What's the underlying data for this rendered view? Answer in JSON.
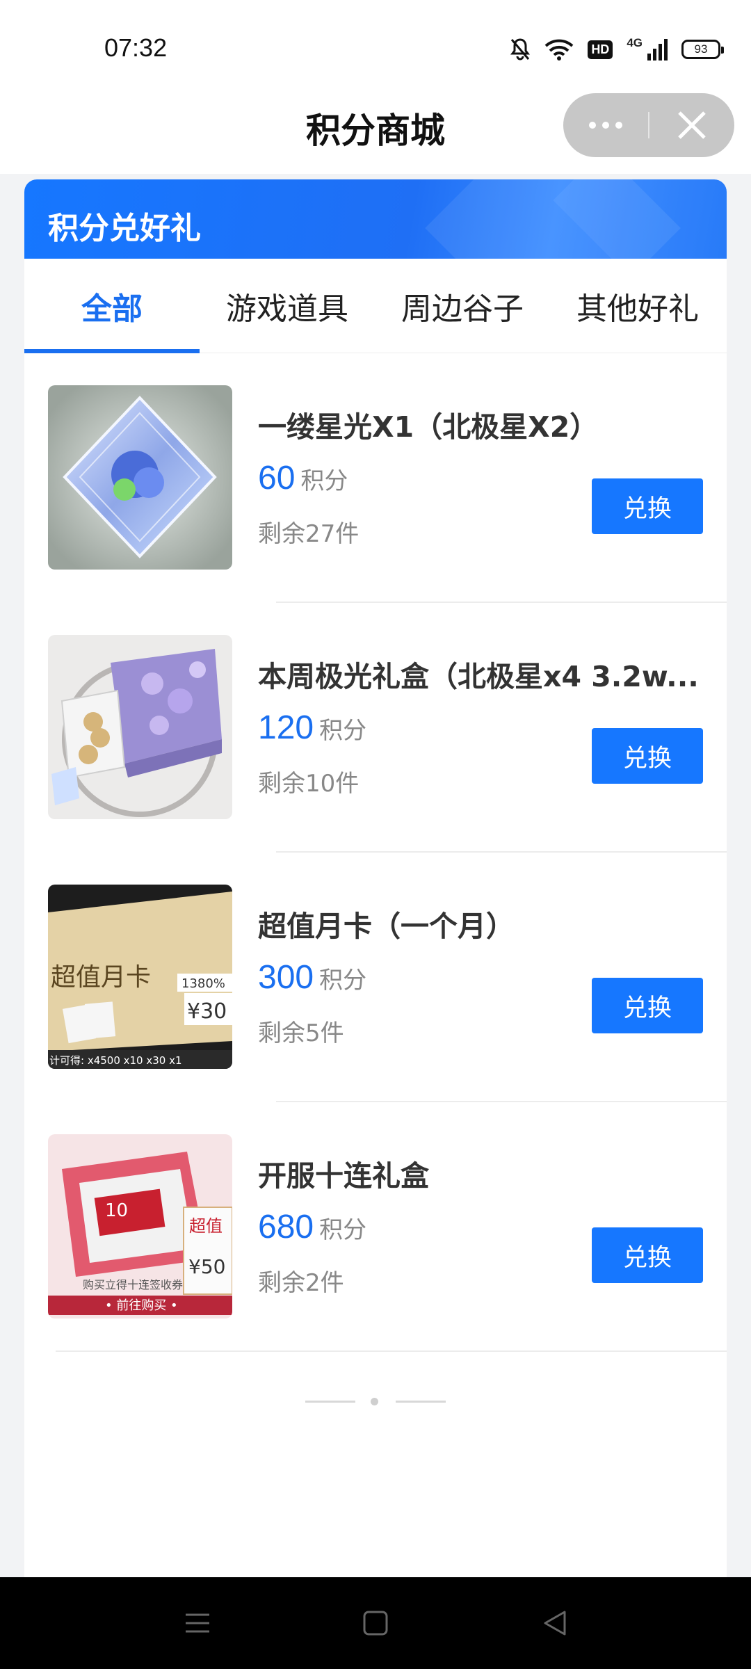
{
  "status_bar": {
    "time": "07:32",
    "network": "4G",
    "hd_badge": "HD",
    "battery_level": "93",
    "icons": [
      "mute-bell-icon",
      "wifi-icon",
      "hd-icon",
      "signal-icon",
      "battery-icon"
    ]
  },
  "header": {
    "title": "积分商城",
    "menu_icon": "more-dots-icon",
    "close_icon": "close-icon"
  },
  "banner": {
    "title": "积分兑好礼"
  },
  "tabs": [
    {
      "label": "全部",
      "active": true
    },
    {
      "label": "游戏道具",
      "active": false
    },
    {
      "label": "周边谷子",
      "active": false
    },
    {
      "label": "其他好礼",
      "active": false
    }
  ],
  "products": [
    {
      "name": "一缕星光X1（北极星X2）",
      "price": "60",
      "unit": "积分",
      "stock": "剩余27件",
      "button": "兑换"
    },
    {
      "name": "本周极光礼盒（北极星x4 3.2w...",
      "price": "120",
      "unit": "积分",
      "stock": "剩余10件",
      "button": "兑换"
    },
    {
      "name": "超值月卡（一个月）",
      "price": "300",
      "unit": "积分",
      "stock": "剩余5件",
      "button": "兑换",
      "thumb_text": {
        "title": "超值月卡",
        "tag": "1380%",
        "price": "¥30",
        "footer": "计可得: x4500 x10 x30 x1"
      }
    },
    {
      "name": "开服十连礼盒",
      "price": "680",
      "unit": "积分",
      "stock": "剩余2件",
      "button": "兑换",
      "thumb_text": {
        "badge": "10",
        "tag": "超值",
        "price": "¥50",
        "caption": "购买立得十连签收券",
        "cta": "• 前往购买 •"
      }
    }
  ],
  "colors": {
    "accent": "#1677ff",
    "price": "#1a6ff0",
    "muted": "#888888",
    "nav_bar": "#000000"
  },
  "nav": {
    "icons": [
      "menu-icon",
      "home-square-icon",
      "back-triangle-icon"
    ]
  }
}
